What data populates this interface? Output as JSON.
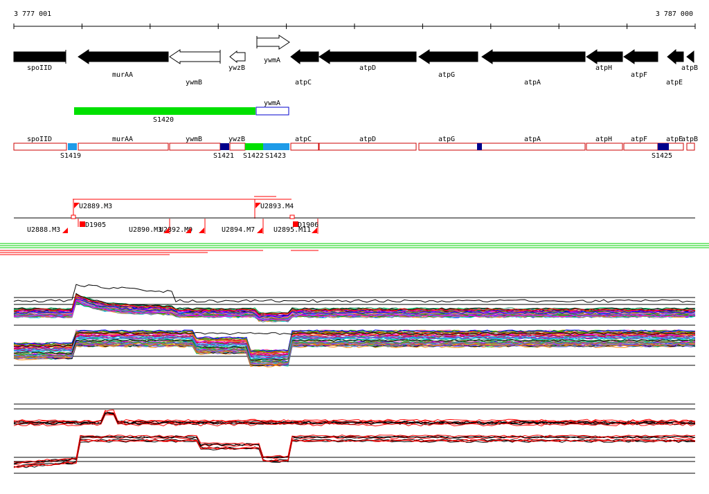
{
  "coords": {
    "start_label": "3 777 001",
    "end_label": "3 787 000"
  },
  "genes": [
    {
      "name": "spoIID",
      "strand": "-",
      "fill": "black"
    },
    {
      "name": "murAA",
      "strand": "-",
      "fill": "black"
    },
    {
      "name": "ywmB",
      "strand": "-",
      "fill": "white"
    },
    {
      "name": "ywzB",
      "strand": "-",
      "fill": "white"
    },
    {
      "name": "ywmA",
      "strand": "+",
      "fill": "white"
    },
    {
      "name": "atpC",
      "strand": "-",
      "fill": "black"
    },
    {
      "name": "atpD",
      "strand": "-",
      "fill": "black"
    },
    {
      "name": "atpG",
      "strand": "-",
      "fill": "black"
    },
    {
      "name": "atpA",
      "strand": "-",
      "fill": "black"
    },
    {
      "name": "atpH",
      "strand": "-",
      "fill": "black"
    },
    {
      "name": "atpF",
      "strand": "-",
      "fill": "black"
    },
    {
      "name": "atpE",
      "strand": "-",
      "fill": "black"
    },
    {
      "name": "atpB",
      "strand": "-",
      "fill": "black"
    }
  ],
  "operon": {
    "segment_label": "S1420",
    "gene_label": "ywmA"
  },
  "track3_genes": [
    "spoIID",
    "murAA",
    "ywmB",
    "ywzB",
    "atpC",
    "atpD",
    "atpG",
    "atpA",
    "atpH",
    "atpF",
    "atpE",
    "atpB"
  ],
  "segments": [
    "S1419",
    "S1421",
    "S1422",
    "S1423",
    "S1425"
  ],
  "upstream_sites": [
    "U2889.M3",
    "U2893.M4",
    "U2888.M3",
    "U2890.M3",
    "U2892.M9",
    "U2894.M7",
    "U2895.M11"
  ],
  "downstream_sites": [
    "D1905",
    "D1906"
  ],
  "colors": {
    "gene_black": "#000000",
    "operon_green": "#00e000",
    "segment_light_blue": "#1e9be8",
    "segment_dark_blue": "#00008b",
    "segment_green": "#00e000",
    "site_red": "#ff0000",
    "gene_outline_red": "#cc0000",
    "outline_blue": "#0000cc"
  }
}
